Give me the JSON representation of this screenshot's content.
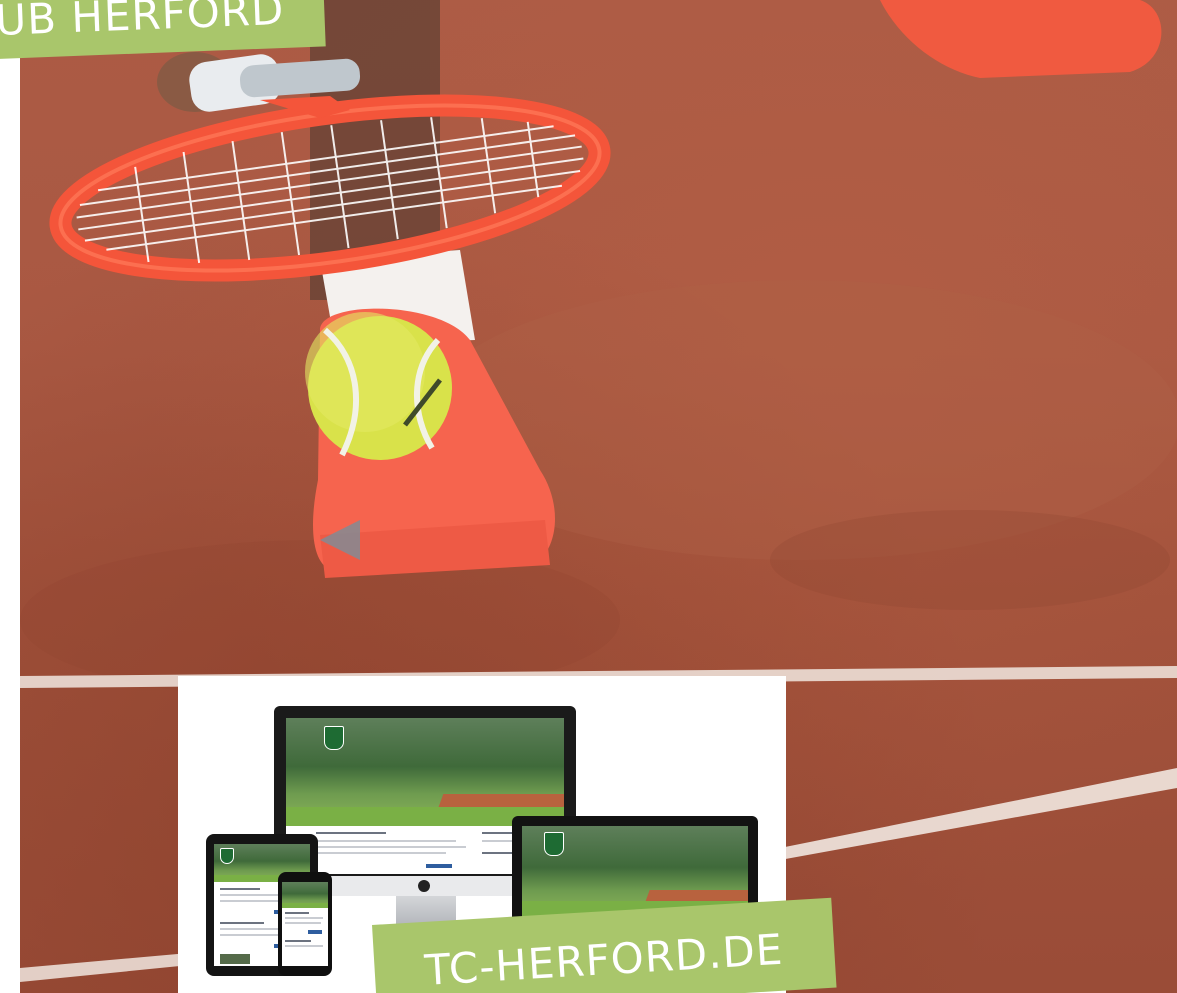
{
  "labels": {
    "club_fragment": "UB HERFORD",
    "website_url": "TC-HERFORD.DE"
  },
  "photo": {
    "subject": "tennis player on clay court with racket and ball",
    "colors": {
      "clay": "#a95842",
      "racket": "#f4553a",
      "ball": "#d9e24a",
      "label_green": "#a9c66b"
    }
  },
  "mockup": {
    "description": "responsive website shown on desktop, laptop, tablet and phone"
  }
}
